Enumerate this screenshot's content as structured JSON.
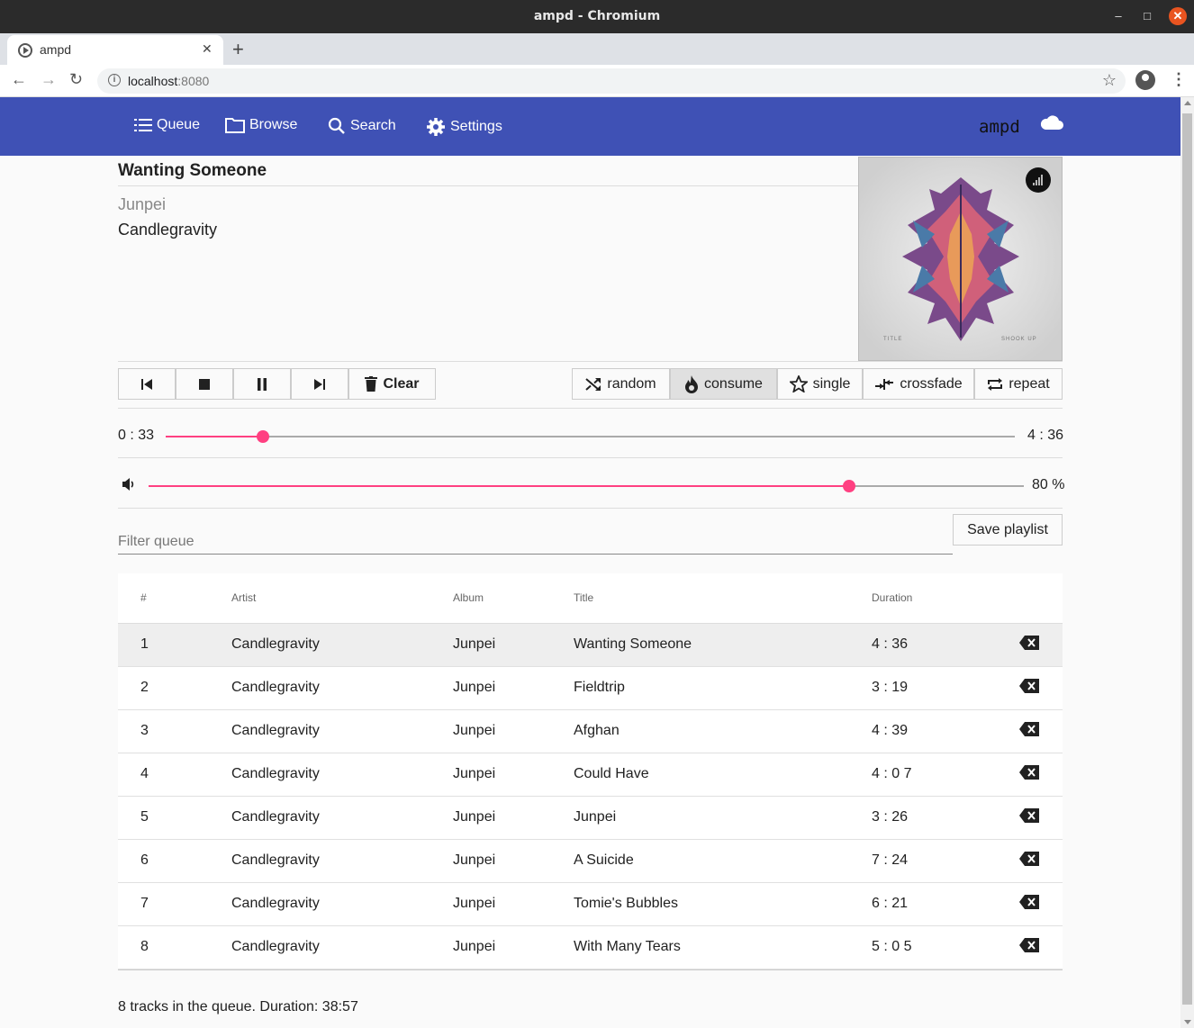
{
  "window": {
    "title": "ampd - Chromium",
    "min": "–",
    "max": "□",
    "close": "✕"
  },
  "browser": {
    "tab_label": "ampd",
    "tab_close": "✕",
    "new_tab": "+",
    "url_host": "localhost",
    "url_port": ":8080",
    "info": "i",
    "bookmark": "☆",
    "menu": "⋮",
    "back": "←",
    "forward": "→",
    "reload": "↻"
  },
  "appbar": {
    "nav": [
      {
        "label": "Queue",
        "icon": "list-icon"
      },
      {
        "label": "Browse",
        "icon": "folder-icon"
      },
      {
        "label": "Search",
        "icon": "search-icon"
      },
      {
        "label": "Settings",
        "icon": "gear-icon"
      }
    ],
    "brand": "ampd",
    "status_icon": "cloud-icon"
  },
  "now_playing": {
    "title": "Wanting Someone",
    "album": "Junpei",
    "artist": "Candlegravity",
    "cover_text_left": "TITLE",
    "cover_text_right": "SHOOK UP"
  },
  "controls": {
    "playback": [
      {
        "name": "previous-button",
        "icon": "skip-previous-icon"
      },
      {
        "name": "stop-button",
        "icon": "stop-icon"
      },
      {
        "name": "pause-button",
        "icon": "pause-icon"
      },
      {
        "name": "next-button",
        "icon": "skip-next-icon"
      }
    ],
    "clear_label": "Clear",
    "modes": [
      {
        "label": "random",
        "icon": "shuffle-icon",
        "active": false
      },
      {
        "label": "consume",
        "icon": "fire-icon",
        "active": true
      },
      {
        "label": "single",
        "icon": "star-icon",
        "active": false
      },
      {
        "label": "crossfade",
        "icon": "crossfade-icon",
        "active": false
      },
      {
        "label": "repeat",
        "icon": "repeat-icon",
        "active": false
      }
    ]
  },
  "progress": {
    "current": "0 : 33",
    "total": "4 : 36",
    "fraction": 0.114
  },
  "volume": {
    "label": "80 %",
    "fraction": 0.8
  },
  "filter": {
    "placeholder": "Filter queue"
  },
  "save_playlist_label": "Save playlist",
  "queue": {
    "columns": [
      "#",
      "Artist",
      "Album",
      "Title",
      "Duration"
    ],
    "rows": [
      {
        "num": "1",
        "artist": "Candlegravity",
        "album": "Junpei",
        "title": "Wanting Someone",
        "duration": "4 : 36",
        "current": true
      },
      {
        "num": "2",
        "artist": "Candlegravity",
        "album": "Junpei",
        "title": "Fieldtrip",
        "duration": "3 : 19",
        "current": false
      },
      {
        "num": "3",
        "artist": "Candlegravity",
        "album": "Junpei",
        "title": "Afghan",
        "duration": "4 : 39",
        "current": false
      },
      {
        "num": "4",
        "artist": "Candlegravity",
        "album": "Junpei",
        "title": "Could Have",
        "duration": "4 : 0 7",
        "current": false
      },
      {
        "num": "5",
        "artist": "Candlegravity",
        "album": "Junpei",
        "title": "Junpei",
        "duration": "3 : 26",
        "current": false
      },
      {
        "num": "6",
        "artist": "Candlegravity",
        "album": "Junpei",
        "title": "A Suicide",
        "duration": "7 : 24",
        "current": false
      },
      {
        "num": "7",
        "artist": "Candlegravity",
        "album": "Junpei",
        "title": "Tomie's Bubbles",
        "duration": "6 : 21",
        "current": false
      },
      {
        "num": "8",
        "artist": "Candlegravity",
        "album": "Junpei",
        "title": "With Many Tears",
        "duration": "5 : 0 5",
        "current": false
      }
    ]
  },
  "summary": "8 tracks in the queue. Duration: 38:57",
  "colors": {
    "appbar": "#3f51b5",
    "accent": "#ff4081"
  }
}
